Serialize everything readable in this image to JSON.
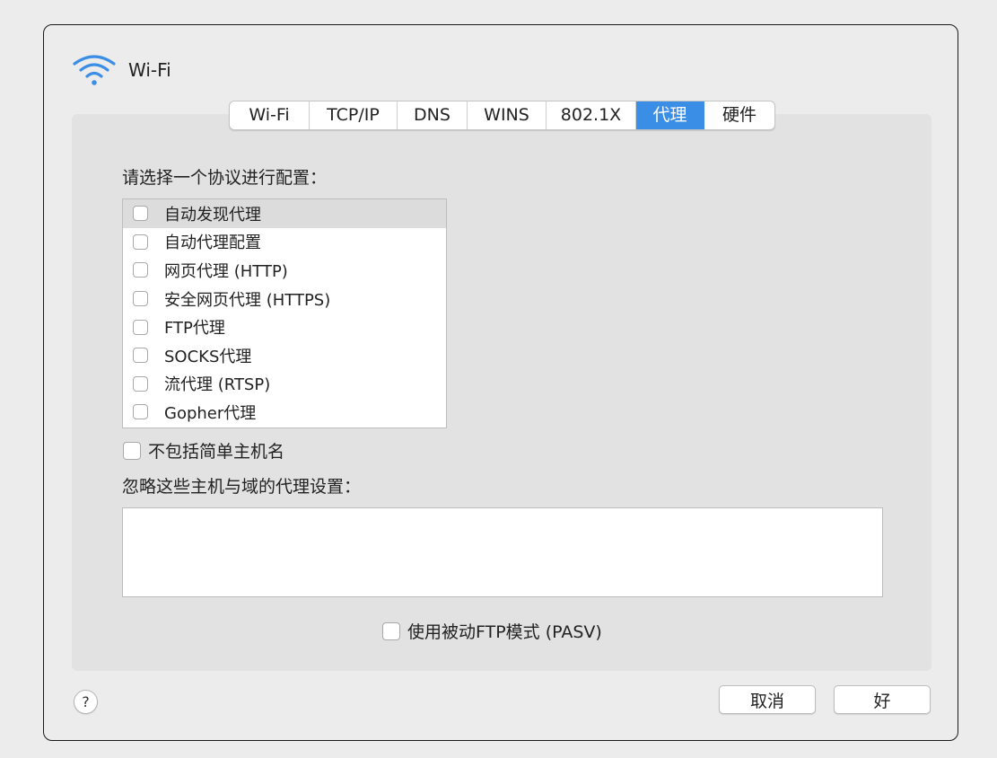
{
  "window": {
    "title": "Wi-Fi",
    "icon": "wifi-icon"
  },
  "tabs": [
    {
      "label": "Wi-Fi",
      "active": false
    },
    {
      "label": "TCP/IP",
      "active": false
    },
    {
      "label": "DNS",
      "active": false
    },
    {
      "label": "WINS",
      "active": false
    },
    {
      "label": "802.1X",
      "active": false
    },
    {
      "label": "代理",
      "active": true
    },
    {
      "label": "硬件",
      "active": false
    }
  ],
  "proxy": {
    "select_label": "请选择一个协议进行配置：",
    "protocols": [
      {
        "label": "自动发现代理",
        "checked": false,
        "selected": true
      },
      {
        "label": "自动代理配置",
        "checked": false,
        "selected": false
      },
      {
        "label": "网页代理 (HTTP)",
        "checked": false,
        "selected": false
      },
      {
        "label": "安全网页代理 (HTTPS)",
        "checked": false,
        "selected": false
      },
      {
        "label": "FTP代理",
        "checked": false,
        "selected": false
      },
      {
        "label": "SOCKS代理",
        "checked": false,
        "selected": false
      },
      {
        "label": "流代理 (RTSP)",
        "checked": false,
        "selected": false
      },
      {
        "label": "Gopher代理",
        "checked": false,
        "selected": false
      }
    ],
    "exclude_simple_hostnames": {
      "label": "不包括简单主机名",
      "checked": false
    },
    "bypass_label": "忽略这些主机与域的代理设置：",
    "bypass_value": "",
    "passive_ftp": {
      "label": "使用被动FTP模式 (PASV)",
      "checked": false
    }
  },
  "footer": {
    "help": "?",
    "cancel": "取消",
    "ok": "好"
  },
  "colors": {
    "accent": "#3a8ee6",
    "wifi_icon": "#3a8ee6"
  }
}
